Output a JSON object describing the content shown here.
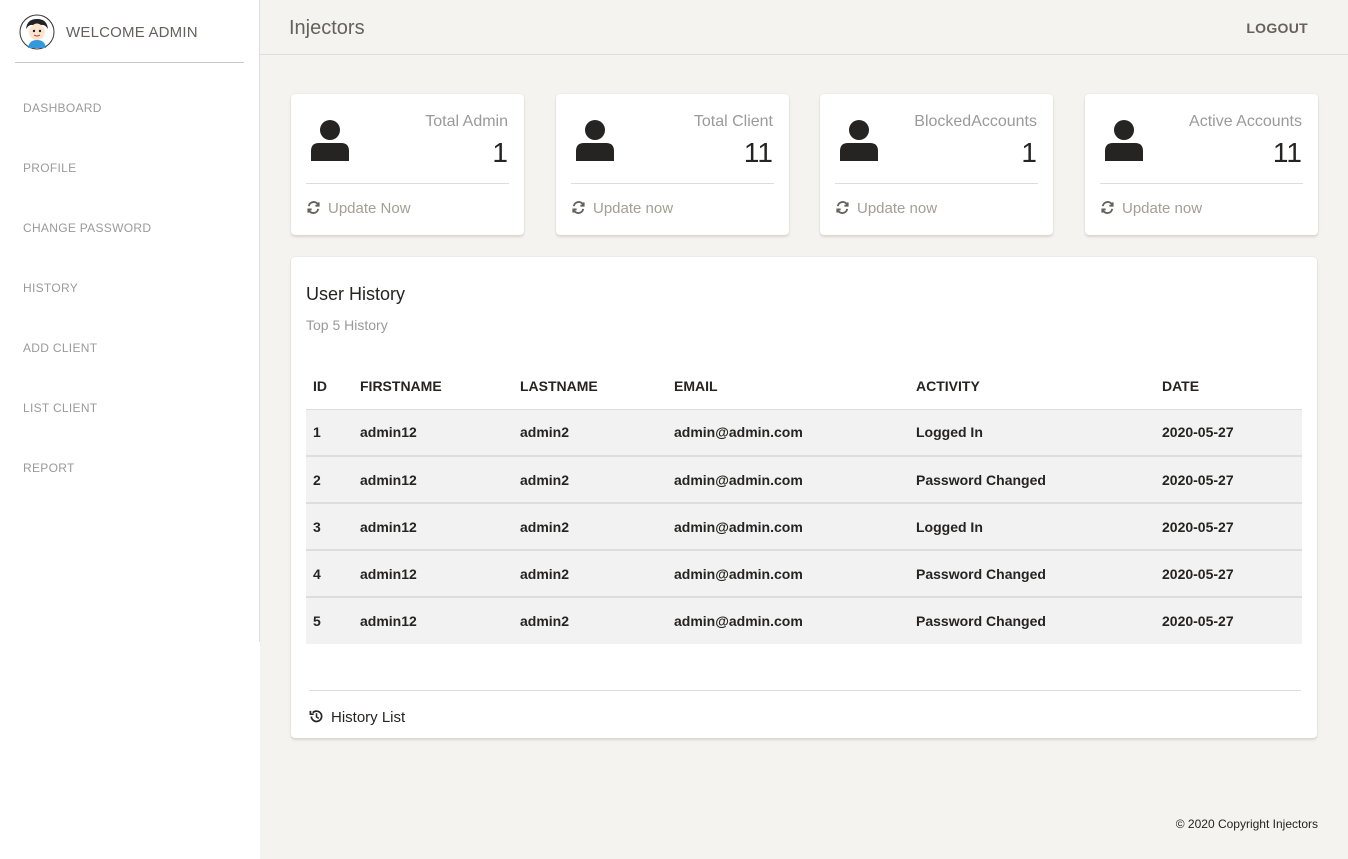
{
  "sidebar": {
    "welcome": "WELCOME ADMIN",
    "items": [
      {
        "label": "DASHBOARD"
      },
      {
        "label": "PROFILE"
      },
      {
        "label": "CHANGE PASSWORD"
      },
      {
        "label": "HISTORY"
      },
      {
        "label": "ADD CLIENT"
      },
      {
        "label": "LIST CLIENT"
      },
      {
        "label": "REPORT"
      }
    ]
  },
  "topbar": {
    "title": "Injectors",
    "logout": "LOGOUT"
  },
  "stats": [
    {
      "label": "Total Admin",
      "value": "1",
      "footer": "Update Now",
      "icon": "user-icon"
    },
    {
      "label": "Total Client",
      "value": "11",
      "footer": "Update now",
      "icon": "user-icon"
    },
    {
      "label": "BlockedAccounts",
      "value": "1",
      "footer": "Update now",
      "icon": "user-icon"
    },
    {
      "label": "Active Accounts",
      "value": "11",
      "footer": "Update now",
      "icon": "user-icon"
    }
  ],
  "history": {
    "title": "User History",
    "subtitle": "Top 5 History",
    "columns": [
      "ID",
      "FIRSTNAME",
      "LASTNAME",
      "EMAIL",
      "ACTIVITY",
      "DATE"
    ],
    "rows": [
      [
        "1",
        "admin12",
        "admin2",
        "admin@admin.com",
        "Logged In",
        "2020-05-27"
      ],
      [
        "2",
        "admin12",
        "admin2",
        "admin@admin.com",
        "Password Changed",
        "2020-05-27"
      ],
      [
        "3",
        "admin12",
        "admin2",
        "admin@admin.com",
        "Logged In",
        "2020-05-27"
      ],
      [
        "4",
        "admin12",
        "admin2",
        "admin@admin.com",
        "Password Changed",
        "2020-05-27"
      ],
      [
        "5",
        "admin12",
        "admin2",
        "admin@admin.com",
        "Password Changed",
        "2020-05-27"
      ]
    ],
    "footer": "History List"
  },
  "footer": {
    "copyright": "© 2020 Copyright Injectors"
  },
  "colors": {
    "background": "#f4f3ef",
    "card": "#ffffff",
    "muted_text": "#9a9a9a",
    "dark_text": "#252422"
  }
}
